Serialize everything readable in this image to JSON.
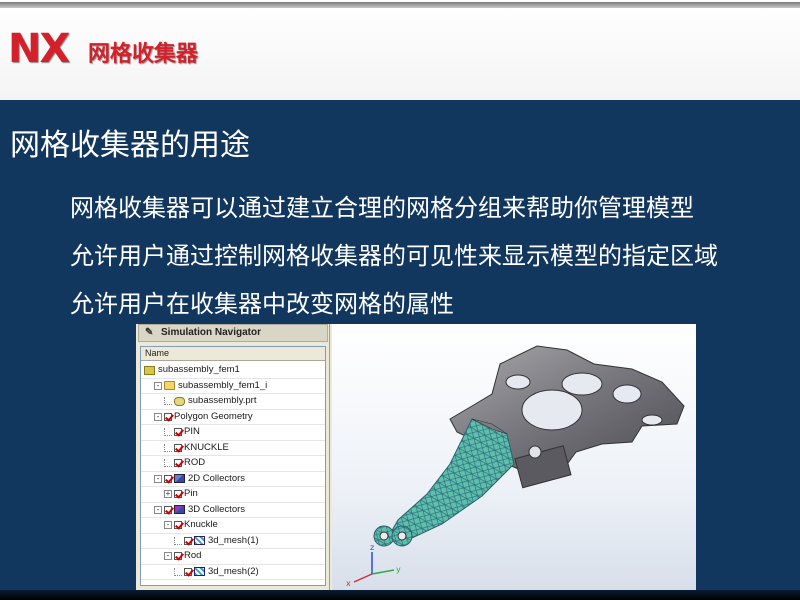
{
  "header": {
    "logo": "NX",
    "title": "网格收集器"
  },
  "slide": {
    "title": "网格收集器的用途",
    "bullets": [
      "网格收集器可以通过建立合理的网格分组来帮助你管理模型",
      "允许用户通过控制网格收集器的可见性来显示模型的指定区域",
      "允许用户在收集器中改变网格的属性"
    ]
  },
  "navigator": {
    "title": "Simulation Navigator",
    "column_header": "Name",
    "items": [
      {
        "label": "subassembly_fem1",
        "level": 0,
        "icon": "fem-icon",
        "expander": "",
        "checked": null
      },
      {
        "label": "subassembly_fem1_i",
        "level": 1,
        "icon": "folder-icon",
        "expander": "-",
        "checked": null
      },
      {
        "label": "subassembly.prt",
        "level": 2,
        "icon": "part-icon",
        "expander": "",
        "checked": null
      },
      {
        "label": "Polygon Geometry",
        "level": 1,
        "icon": "",
        "expander": "-",
        "checked": true
      },
      {
        "label": "PIN",
        "level": 2,
        "icon": "",
        "expander": "",
        "checked": true
      },
      {
        "label": "KNUCKLE",
        "level": 2,
        "icon": "",
        "expander": "",
        "checked": true
      },
      {
        "label": "ROD",
        "level": 2,
        "icon": "",
        "expander": "",
        "checked": true
      },
      {
        "label": "2D Collectors",
        "level": 1,
        "icon": "collector-2d-icon",
        "expander": "-",
        "checked": true
      },
      {
        "label": "Pin",
        "level": 2,
        "icon": "",
        "expander": "+",
        "checked": true
      },
      {
        "label": "3D Collectors",
        "level": 1,
        "icon": "collector-3d-icon",
        "expander": "-",
        "checked": true
      },
      {
        "label": "Knuckle",
        "level": 2,
        "icon": "",
        "expander": "-",
        "checked": true
      },
      {
        "label": "3d_mesh(1)",
        "level": 3,
        "icon": "mesh-icon",
        "expander": "",
        "checked": true
      },
      {
        "label": "Rod",
        "level": 2,
        "icon": "",
        "expander": "-",
        "checked": true
      },
      {
        "label": "3d_mesh(2)",
        "level": 3,
        "icon": "mesh-icon",
        "expander": "",
        "checked": true
      }
    ]
  },
  "viewport": {
    "triad_labels": {
      "x": "x",
      "y": "y",
      "z": "z"
    }
  },
  "colors": {
    "brand_red": "#d4202a",
    "panel_navy": "#12375f",
    "model_gray": "#7d7d80",
    "mesh_teal": "#4fb3a0"
  }
}
